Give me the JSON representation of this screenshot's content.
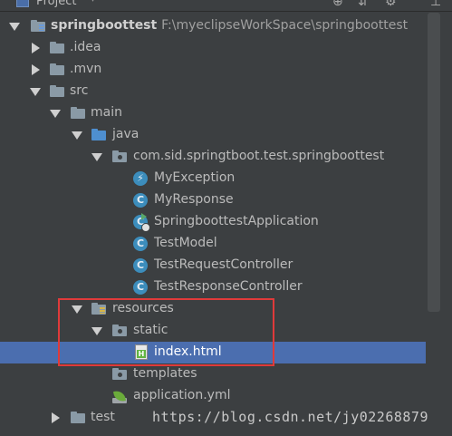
{
  "header": {
    "title": "Project"
  },
  "tree": {
    "root": {
      "name": "springboottest",
      "path": "F:\\myeclipseWorkSpace\\springboottest"
    },
    "idea": ".idea",
    "mvn": ".mvn",
    "src": "src",
    "main": "main",
    "java": "java",
    "package": "com.sid.springtboot.test.springboottest",
    "classes": [
      "MyException",
      "MyResponse",
      "SpringboottestApplication",
      "TestModel",
      "TestRequestController",
      "TestResponseController"
    ],
    "resources": "resources",
    "static": "static",
    "index": "index.html",
    "templates": "templates",
    "application_yml": "application.yml",
    "test": "test"
  },
  "watermark": "https://blog.csdn.net/jy02268879",
  "colors": {
    "background": "#3c3f41",
    "selection": "#4b6eaf",
    "highlight_box": "#e03a3a"
  }
}
